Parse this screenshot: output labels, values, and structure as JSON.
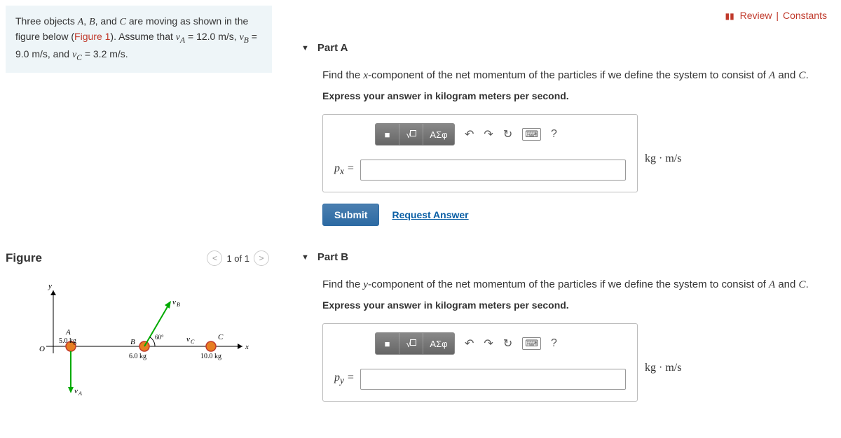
{
  "top_links": {
    "review": "Review",
    "constants": "Constants"
  },
  "problem": {
    "text_1": "Three objects ",
    "text_2": ", ",
    "text_3": ", and ",
    "text_4": " are moving as shown in the figure below (",
    "fig_link": "Figure 1",
    "text_5": "). Assume that ",
    "vA": "v",
    "vA_sub": "A",
    "eq1": " = 12.0 m/s, ",
    "vB": "v",
    "vB_sub": "B",
    "eq2": " = 9.0 m/s, and ",
    "vC": "v",
    "vC_sub": "C",
    "eq3": " = 3.2 m/s.",
    "A": "A",
    "B": "B",
    "C": "C"
  },
  "figure": {
    "title": "Figure",
    "nav_label": "1 of 1",
    "labels": {
      "y": "y",
      "x": "x",
      "A": "A",
      "B": "B",
      "C": "C",
      "mA": "5.0 kg",
      "mB": "6.0 kg",
      "mC": "10.0 kg",
      "vA": "v",
      "vA_sub": "A",
      "vB": "v",
      "vB_sub": "B",
      "vC": "v",
      "vC_sub": "C",
      "angle": "60°",
      "O": "O"
    }
  },
  "parts": {
    "A": {
      "title": "Part A",
      "prompt_1": "Find the ",
      "axis": "x",
      "prompt_2": "-component of the net momentum of the particles if we define the system to consist of ",
      "prompt_3": " and ",
      "prompt_4": ".",
      "sysA": "A",
      "sysC": "C",
      "instruct": "Express your answer in kilogram meters per second.",
      "var": "p",
      "var_sub": "x",
      "eq": " = ",
      "unit": "kg · m/s",
      "submit": "Submit",
      "request": "Request Answer"
    },
    "B": {
      "title": "Part B",
      "prompt_1": "Find the ",
      "axis": "y",
      "prompt_2": "-component of the net momentum of the particles if we define the system to consist of ",
      "prompt_3": " and ",
      "prompt_4": ".",
      "sysA": "A",
      "sysC": "C",
      "instruct": "Express your answer in kilogram meters per second.",
      "var": "p",
      "var_sub": "y",
      "eq": " = ",
      "unit": "kg · m/s"
    }
  },
  "toolbar": {
    "templates": "■",
    "radical": "√",
    "greek": "ΑΣφ",
    "undo": "↶",
    "redo": "↷",
    "reset": "↻",
    "keyboard": "⌨",
    "help": "?"
  }
}
